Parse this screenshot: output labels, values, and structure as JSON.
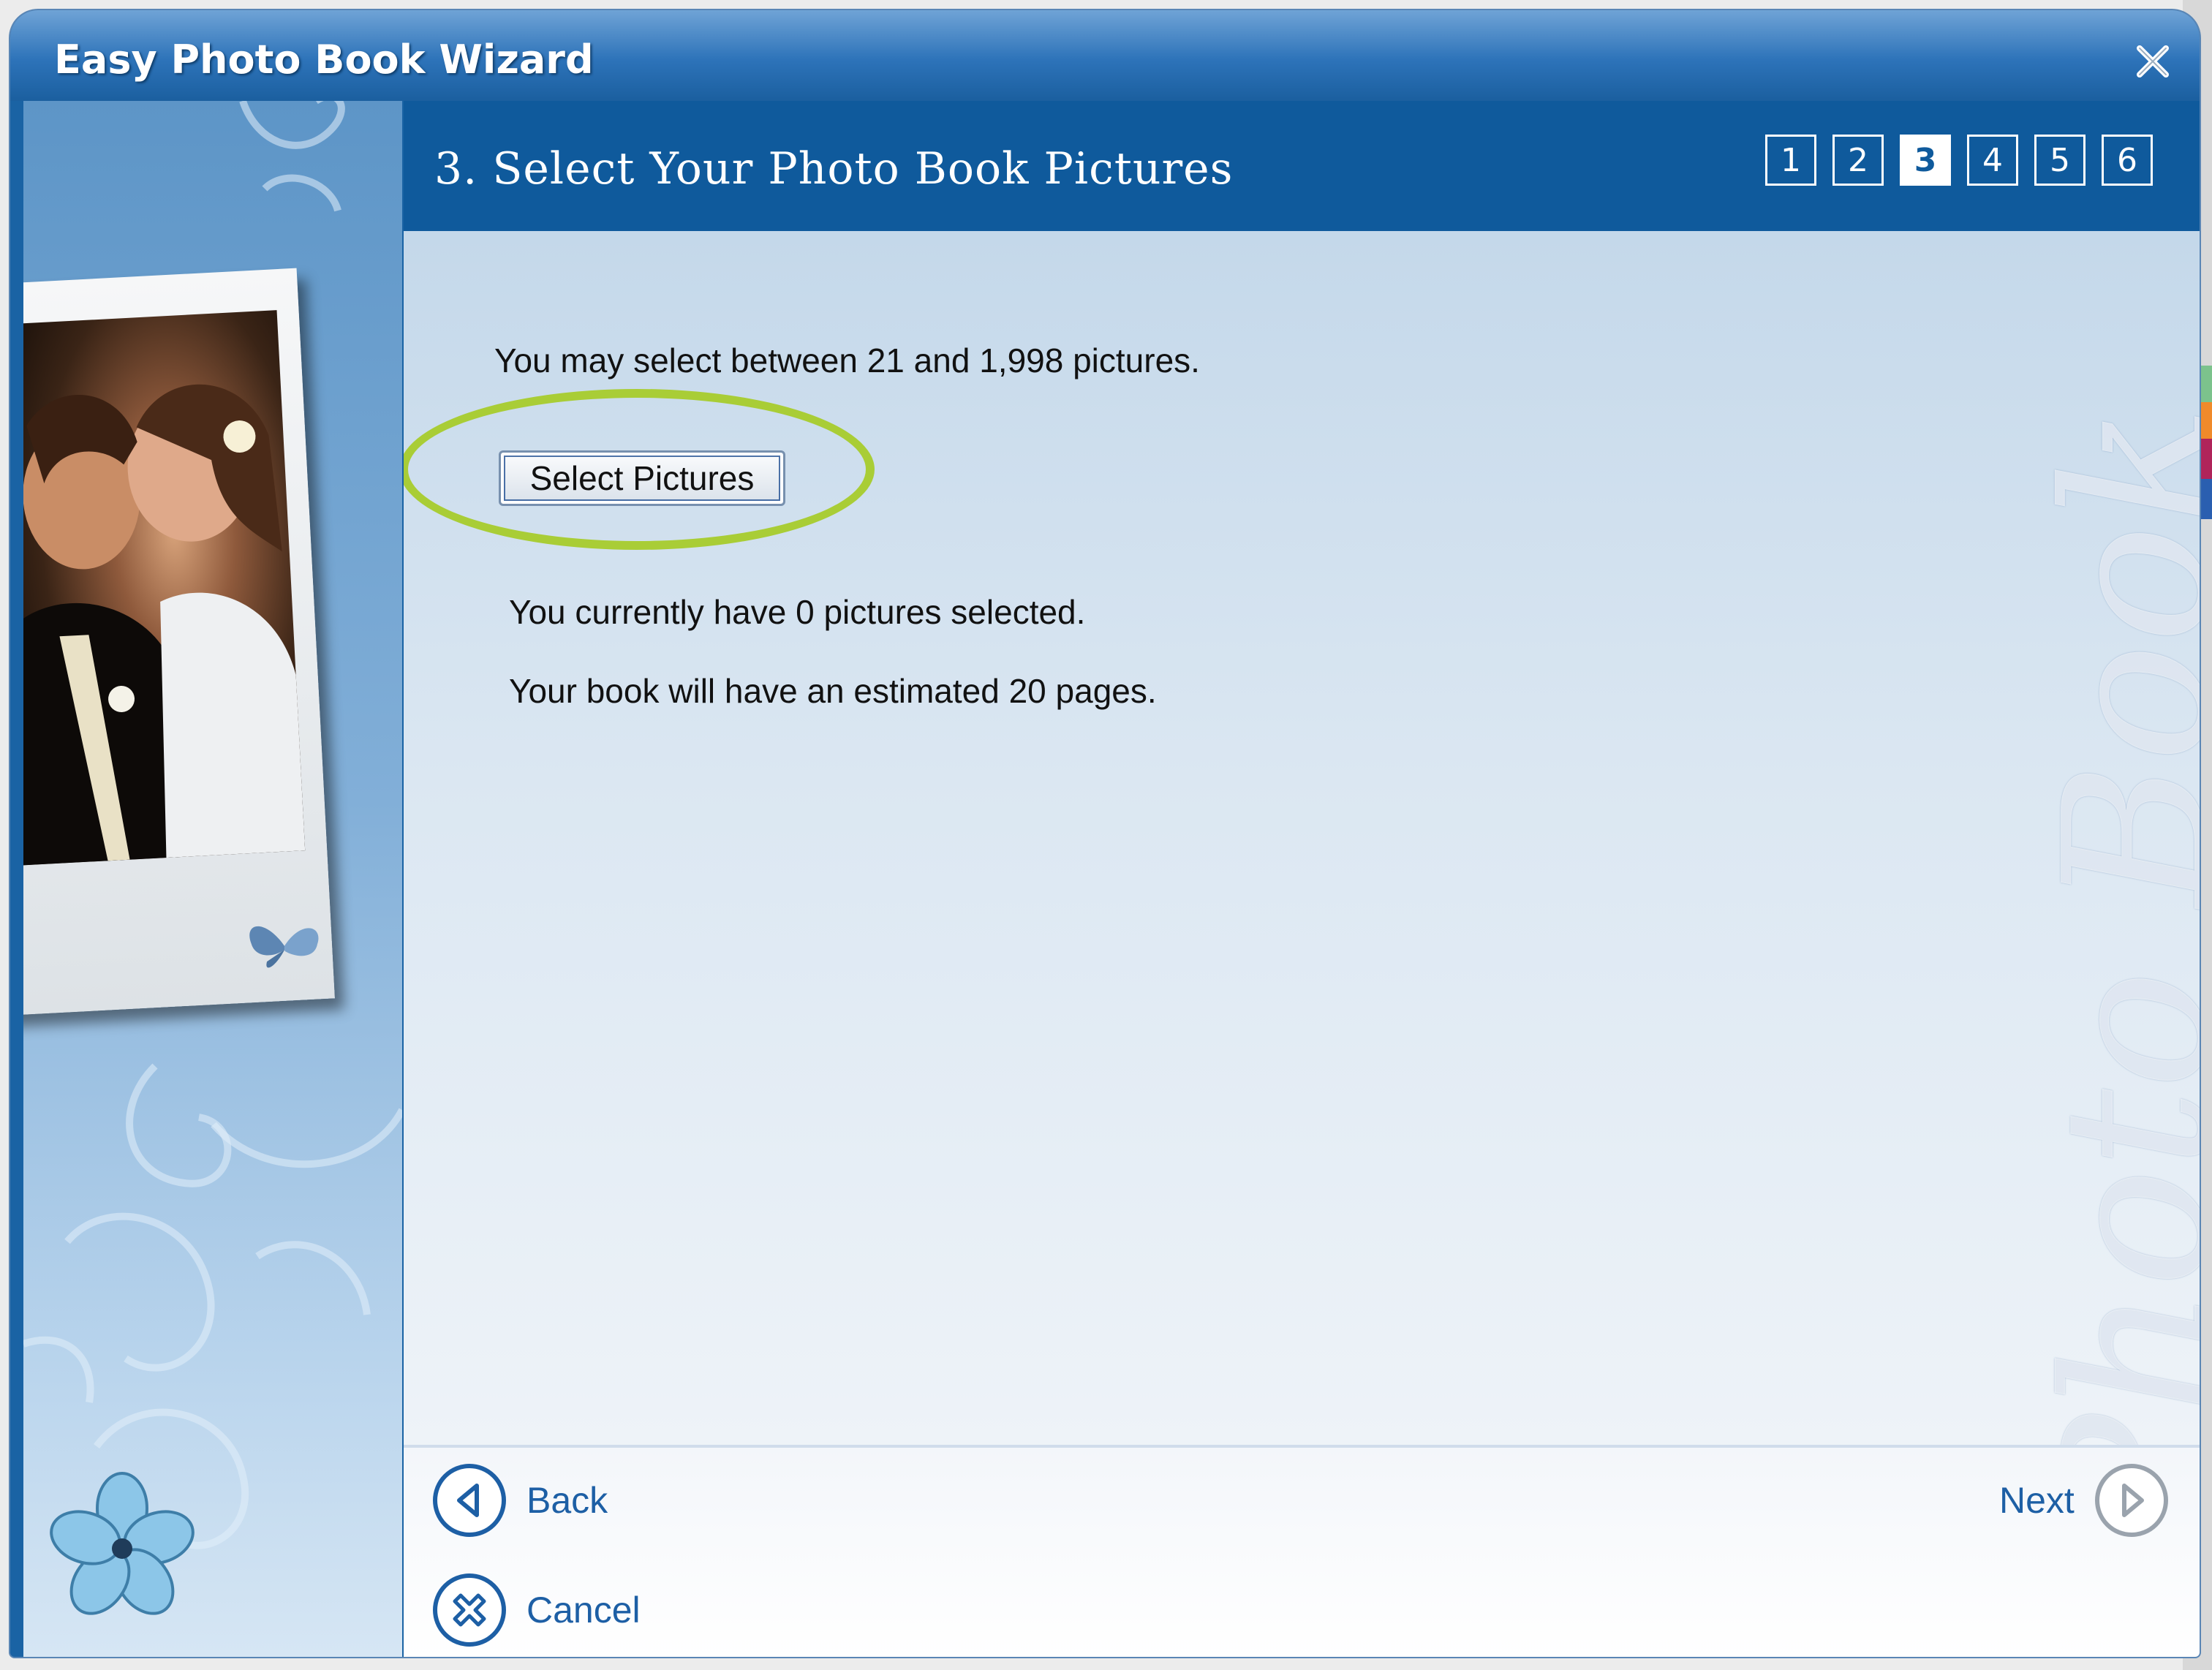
{
  "window": {
    "title": "Easy Photo Book Wizard",
    "close_icon": "close-icon"
  },
  "header": {
    "step_title": "3. Select Your Photo Book Pictures",
    "steps": [
      "1",
      "2",
      "3",
      "4",
      "5",
      "6"
    ],
    "active_step": "3"
  },
  "content": {
    "range_text": "You may select between 21 and 1,998 pictures.",
    "select_button_label": "Select Pictures",
    "selected_text": "You currently have 0 pictures selected.",
    "pages_text": "Your book will have an estimated 20 pages.",
    "watermark": "Photo Book",
    "highlight_color": "#a9cd36"
  },
  "footer": {
    "back_label": "Back",
    "cancel_label": "Cancel",
    "next_label": "Next"
  },
  "colors": {
    "header_blue": "#0f5a9c",
    "link_blue": "#1d5fa5"
  }
}
